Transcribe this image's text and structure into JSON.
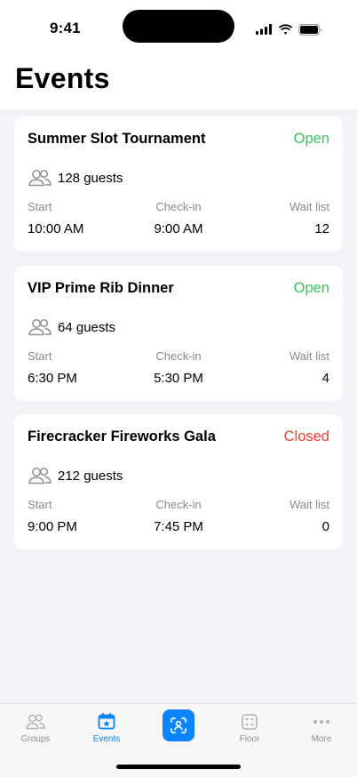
{
  "status_bar": {
    "time": "9:41"
  },
  "page": {
    "title": "Events"
  },
  "events": [
    {
      "name": "Summer Slot Tournament",
      "status": "Open",
      "guests": "128 guests",
      "labels": {
        "start": "Start",
        "checkin": "Check-in",
        "waitlist": "Wait list"
      },
      "start": "10:00 AM",
      "checkin": "9:00 AM",
      "waitlist": "12"
    },
    {
      "name": "VIP Prime Rib Dinner",
      "status": "Open",
      "guests": "64 guests",
      "labels": {
        "start": "Start",
        "checkin": "Check-in",
        "waitlist": "Wait list"
      },
      "start": "6:30 PM",
      "checkin": "5:30 PM",
      "waitlist": "4"
    },
    {
      "name": "Firecracker Fireworks Gala",
      "status": "Closed",
      "guests": "212 guests",
      "labels": {
        "start": "Start",
        "checkin": "Check-in",
        "waitlist": "Wait list"
      },
      "start": "9:00 PM",
      "checkin": "7:45 PM",
      "waitlist": "0"
    }
  ],
  "tab_bar": {
    "groups": {
      "label": "Groups",
      "icon": "people-icon"
    },
    "events": {
      "label": "Events",
      "icon": "calendar-star-icon"
    },
    "scan": {
      "icon": "face-scan-icon"
    },
    "floor": {
      "label": "Floor",
      "icon": "dice-icon"
    },
    "more": {
      "label": "More",
      "icon": "ellipsis-icon"
    }
  },
  "colors": {
    "accent": "#0a84ff",
    "open": "#34c759",
    "closed": "#ff3b30",
    "background": "#f2f2f7"
  }
}
